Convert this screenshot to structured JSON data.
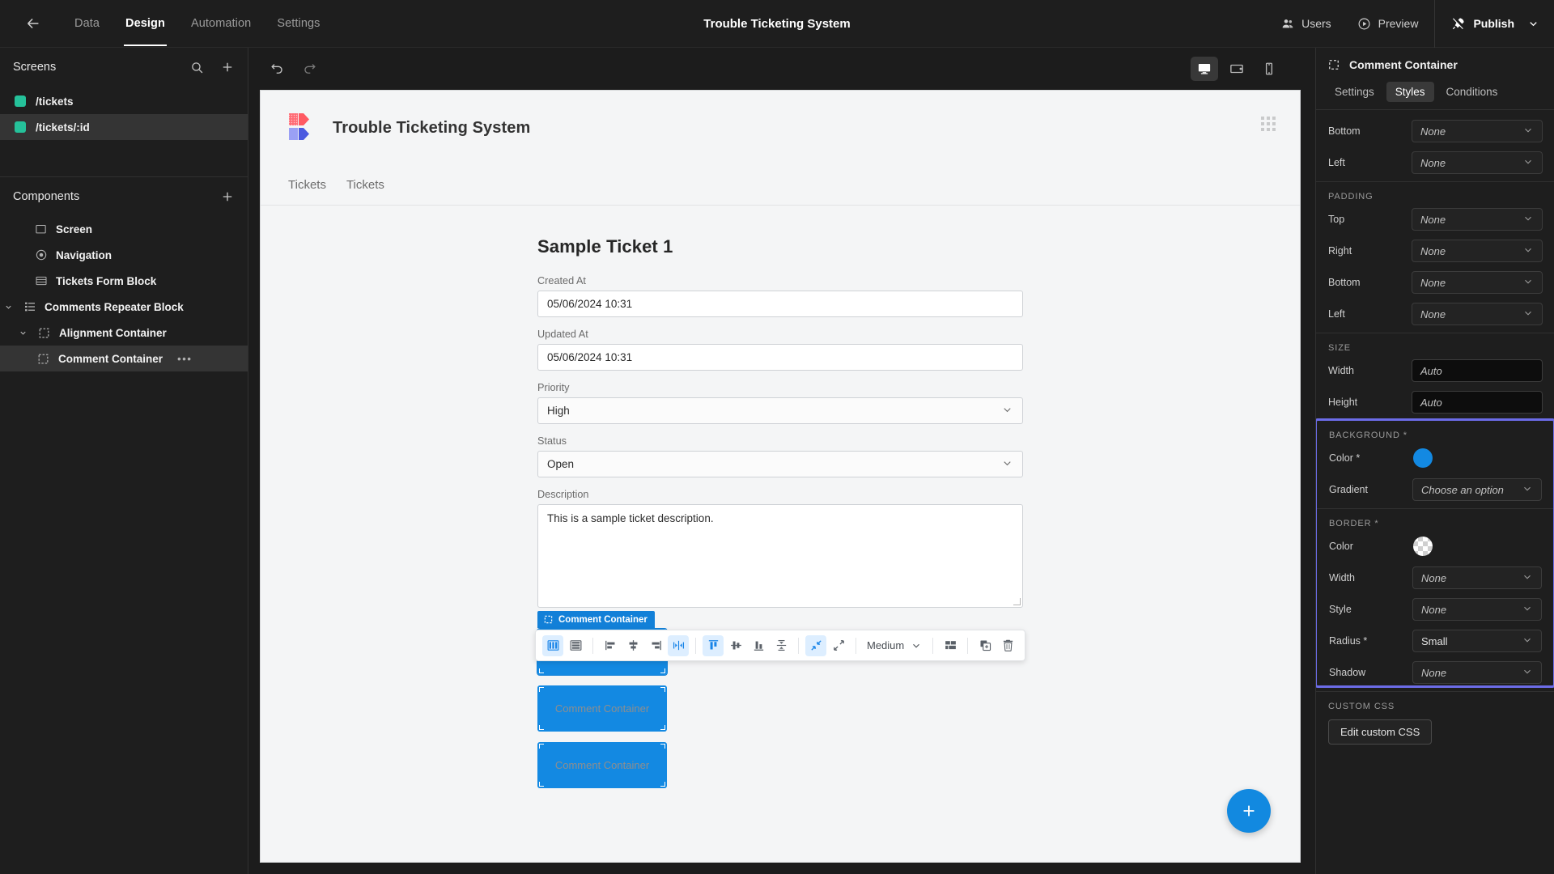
{
  "topbar": {
    "back_icon": "arrow-left-icon",
    "nav": [
      {
        "label": "Data",
        "active": false
      },
      {
        "label": "Design",
        "active": true
      },
      {
        "label": "Automation",
        "active": false
      },
      {
        "label": "Settings",
        "active": false
      }
    ],
    "app_title": "Trouble Ticketing System",
    "users_label": "Users",
    "preview_label": "Preview",
    "publish_label": "Publish"
  },
  "left_panel": {
    "screens_header": "Screens",
    "screens": [
      {
        "label": "/tickets",
        "color": "#25c19a",
        "selected": false
      },
      {
        "label": "/tickets/:id",
        "color": "#25c19a",
        "selected": true
      }
    ],
    "components_header": "Components",
    "components": [
      {
        "label": "Screen",
        "icon": "screen-icon",
        "indent": 0,
        "caret": "",
        "selected": false,
        "dots": false
      },
      {
        "label": "Navigation",
        "icon": "navigation-icon",
        "indent": 0,
        "caret": "",
        "selected": false,
        "dots": false
      },
      {
        "label": "Tickets Form Block",
        "icon": "form-block-icon",
        "indent": 0,
        "caret": "",
        "selected": false,
        "dots": false
      },
      {
        "label": "Comments Repeater Block",
        "icon": "repeater-block-icon",
        "indent": 0,
        "caret": "expanded",
        "selected": false,
        "dots": false
      },
      {
        "label": "Alignment Container",
        "icon": "container-icon",
        "indent": 1,
        "caret": "expanded",
        "selected": false,
        "dots": false
      },
      {
        "label": "Comment Container",
        "icon": "container-icon",
        "indent": 2,
        "caret": "",
        "selected": true,
        "dots": true
      }
    ],
    "more_dots": "•••"
  },
  "canvas": {
    "undo_icon": "undo-icon",
    "redo_icon": "redo-icon",
    "devices": [
      {
        "name": "desktop-icon",
        "active": true
      },
      {
        "name": "tablet-icon",
        "active": false
      },
      {
        "name": "mobile-icon",
        "active": false
      }
    ]
  },
  "preview": {
    "brand_title": "Trouble Ticketing System",
    "tabs": [
      "Tickets",
      "Tickets"
    ],
    "form_title": "Sample Ticket 1",
    "fields": [
      {
        "label": "Created At",
        "value": "05/06/2024 10:31",
        "type": "input"
      },
      {
        "label": "Updated At",
        "value": "05/06/2024 10:31",
        "type": "input"
      },
      {
        "label": "Priority",
        "value": "High",
        "type": "select"
      },
      {
        "label": "Status",
        "value": "Open",
        "type": "select"
      },
      {
        "label": "Description",
        "value": "This is a sample ticket description.",
        "type": "textarea"
      }
    ],
    "comment_tag": "Comment Container",
    "comments": [
      "Comment Container",
      "Comment Container",
      "Comment Container"
    ],
    "fab_icon": "plus-icon"
  },
  "float_toolbar": {
    "groups": [
      [
        {
          "icon": "layout-columns-icon",
          "active": true
        },
        {
          "icon": "layout-rows-icon",
          "active": false
        }
      ],
      [
        {
          "icon": "align-left-icon",
          "active": false
        },
        {
          "icon": "align-center-horizontal-icon",
          "active": false
        },
        {
          "icon": "align-right-icon",
          "active": false
        },
        {
          "icon": "distribute-horizontal-icon",
          "active": true
        }
      ],
      [
        {
          "icon": "align-top-icon",
          "active": true
        },
        {
          "icon": "align-middle-icon",
          "active": false
        },
        {
          "icon": "align-bottom-icon",
          "active": false
        },
        {
          "icon": "distribute-vertical-icon",
          "active": false
        }
      ],
      [
        {
          "icon": "collapse-arrows-icon",
          "active": true
        },
        {
          "icon": "expand-arrows-icon",
          "active": false
        }
      ]
    ],
    "size_select": "Medium",
    "grid_icon": "grid-layout-icon",
    "duplicate_icon": "duplicate-icon",
    "delete_icon": "trash-icon"
  },
  "right_panel": {
    "title": "Comment Container",
    "title_icon": "container-icon",
    "tabs": [
      {
        "label": "Settings",
        "active": false
      },
      {
        "label": "Styles",
        "active": true
      },
      {
        "label": "Conditions",
        "active": false
      }
    ],
    "margin_rows": [
      {
        "label": "Bottom",
        "value": "None"
      },
      {
        "label": "Left",
        "value": "None"
      }
    ],
    "padding_label": "PADDING",
    "padding_rows": [
      {
        "label": "Top",
        "value": "None"
      },
      {
        "label": "Right",
        "value": "None"
      },
      {
        "label": "Bottom",
        "value": "None"
      },
      {
        "label": "Left",
        "value": "None"
      }
    ],
    "size_label": "SIZE",
    "size_rows": [
      {
        "label": "Width",
        "value": "Auto"
      },
      {
        "label": "Height",
        "value": "Auto"
      }
    ],
    "background_label": "BACKGROUND *",
    "background_color_label": "Color *",
    "background_color": "#1389e2",
    "gradient_label": "Gradient",
    "gradient_value": "Choose an option",
    "border_label": "BORDER *",
    "border_color_label": "Color",
    "border_color": "transparent",
    "border_rows": [
      {
        "label": "Width",
        "value": "None",
        "italic": true
      },
      {
        "label": "Style",
        "value": "None",
        "italic": true
      },
      {
        "label": "Radius *",
        "value": "Small",
        "italic": false
      },
      {
        "label": "Shadow",
        "value": "None",
        "italic": true
      }
    ],
    "custom_css_label": "CUSTOM CSS",
    "custom_css_button": "Edit custom CSS",
    "highlight_color": "#6c6ce8"
  }
}
